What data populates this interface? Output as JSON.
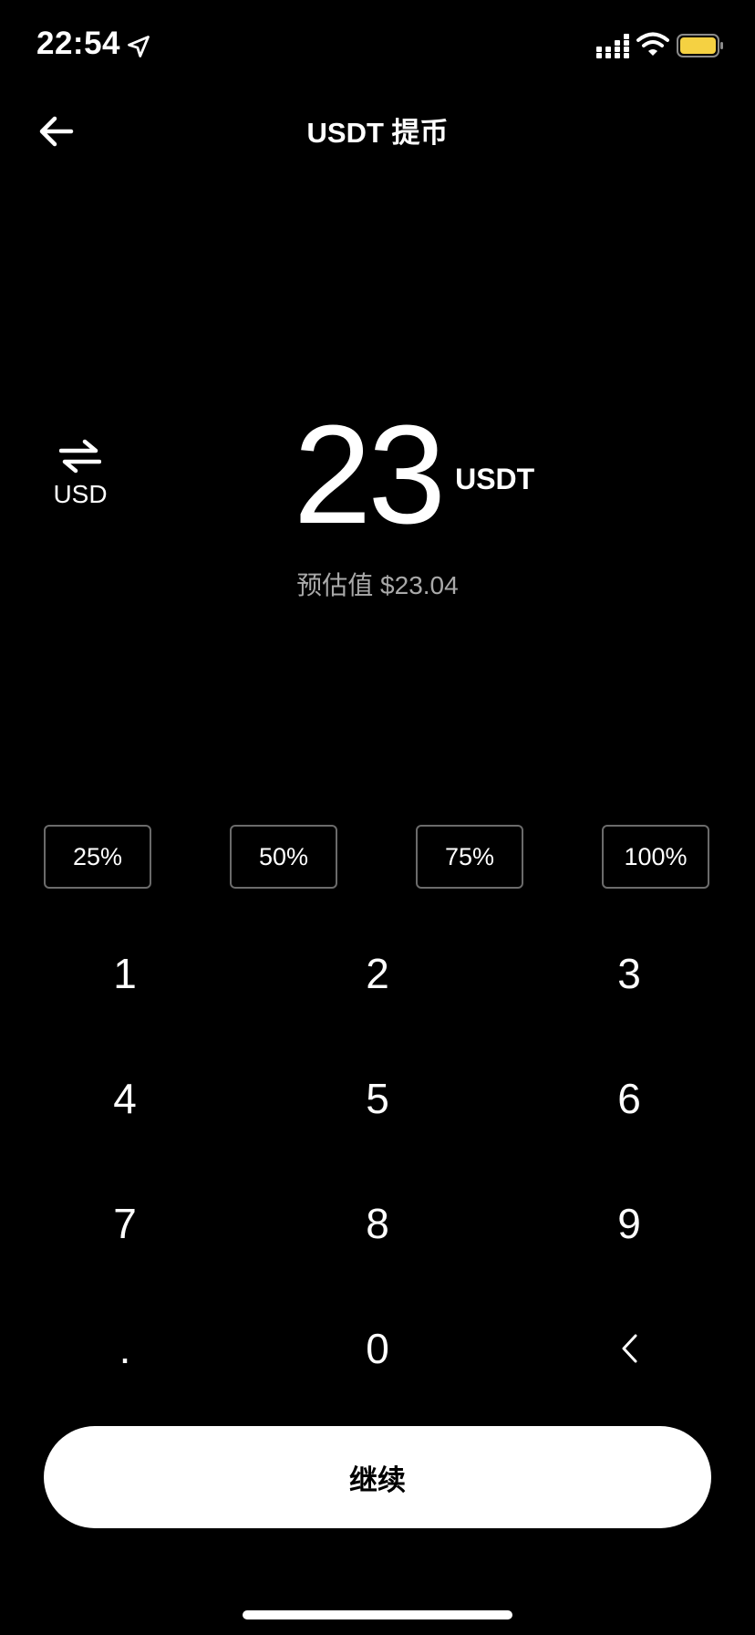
{
  "status_bar": {
    "time": "22:54",
    "icons": [
      "location-arrow-icon",
      "signal-icon",
      "wifi-icon",
      "battery-icon"
    ],
    "battery_color": "#f5d142"
  },
  "header": {
    "back_icon": "arrow-left-icon",
    "title": "USDT 提币"
  },
  "currency_switch": {
    "icon": "swap-icon",
    "label": "USD"
  },
  "amount": {
    "value": "23",
    "unit": "USDT",
    "estimate": "预估值 $23.04"
  },
  "percent_buttons": [
    "25%",
    "50%",
    "75%",
    "100%"
  ],
  "keypad": {
    "keys": [
      "1",
      "2",
      "3",
      "4",
      "5",
      "6",
      "7",
      "8",
      "9",
      ".",
      "0"
    ],
    "backspace_icon": "chevron-left-icon"
  },
  "continue_button": {
    "label": "继续"
  },
  "colors": {
    "background": "#000000",
    "text": "#ffffff",
    "muted_text": "#a9a9a9",
    "button_border": "#6b6b6b",
    "primary_button": "#ffffff"
  }
}
